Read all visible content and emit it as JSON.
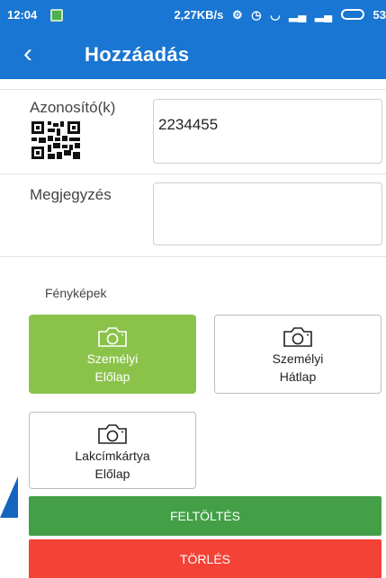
{
  "status_bar": {
    "time": "12:04",
    "network_speed": "2,27KB/s",
    "battery": "53"
  },
  "header": {
    "back_icon": "chevron-left-icon",
    "title": "Hozzáadás",
    "color": "#1976d2"
  },
  "form": {
    "identifier": {
      "label": "Azonosító(k)",
      "value": "2234455",
      "scan_icon": "qr-code-icon"
    },
    "note": {
      "label": "Megjegyzés",
      "value": ""
    }
  },
  "photos": {
    "section_label": "Fényképek",
    "items": [
      {
        "line1": "Személyi",
        "line2": "Előlap",
        "state": "active"
      },
      {
        "line1": "Személyi",
        "line2": "Hátlap",
        "state": "inactive"
      },
      {
        "line1": "Lakcímkártya",
        "line2": "Előlap",
        "state": "inactive"
      }
    ],
    "icon": "camera-icon",
    "active_color": "#8bc34a"
  },
  "actions": {
    "upload_label": "FELTÖLTÉS",
    "delete_label": "TÖRLÉS",
    "upload_color": "#43a047",
    "delete_color": "#f44336"
  }
}
